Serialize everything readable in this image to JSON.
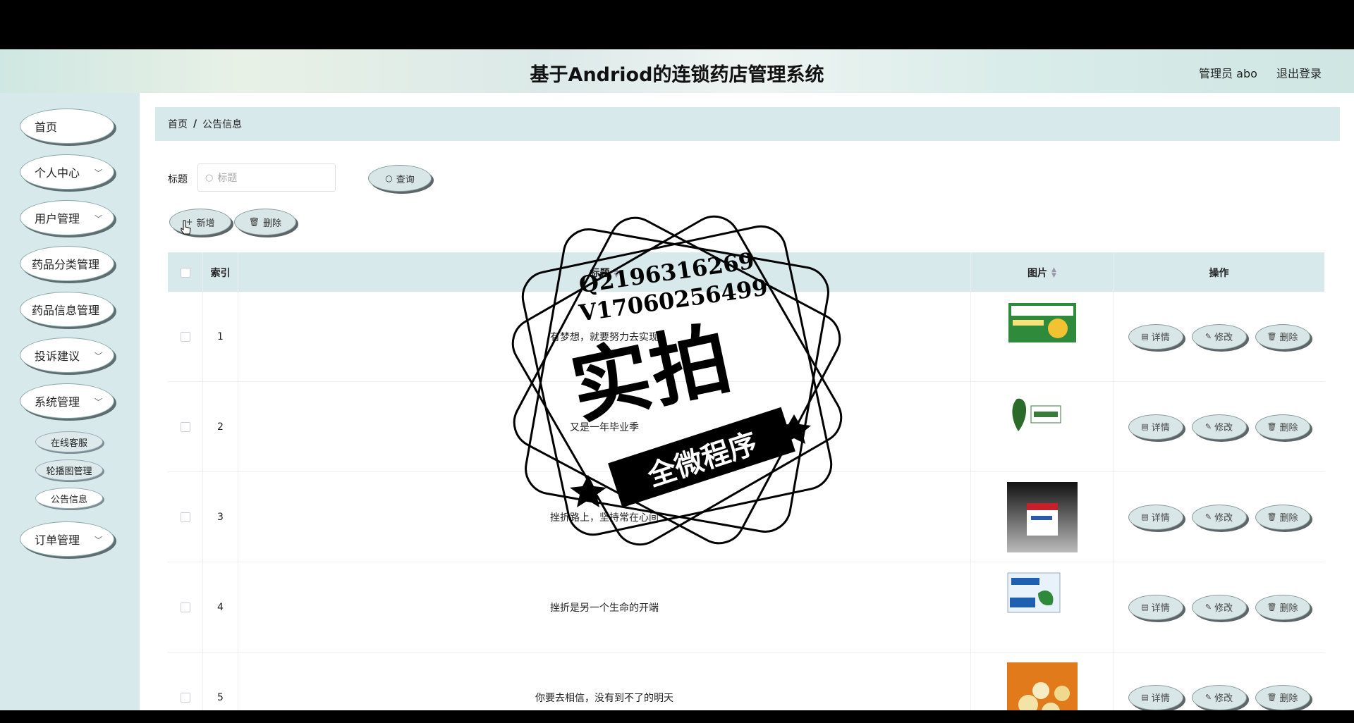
{
  "header": {
    "title": "基于Andriod的连锁药店管理系统",
    "user": "管理员 abo",
    "logout": "退出登录"
  },
  "sidebar": {
    "items": [
      {
        "label": "首页"
      },
      {
        "label": "个人中心"
      },
      {
        "label": "用户管理"
      },
      {
        "label": "药品分类管理"
      },
      {
        "label": "药品信息管理"
      },
      {
        "label": "投诉建议"
      },
      {
        "label": "系统管理"
      },
      {
        "label": "订单管理"
      }
    ],
    "sub_items": [
      {
        "label": "在线客服"
      },
      {
        "label": "轮播图管理"
      },
      {
        "label": "公告信息"
      }
    ]
  },
  "breadcrumb": {
    "home": "首页",
    "sep": "/",
    "current": "公告信息"
  },
  "search": {
    "label": "标题",
    "placeholder": "标题",
    "button": "查询"
  },
  "actions": {
    "add": "新增",
    "delete": "删除"
  },
  "table": {
    "headers": {
      "index": "索引",
      "title": "标题",
      "image": "图片",
      "ops": "操作"
    },
    "op_labels": {
      "detail": "详情",
      "edit": "修改",
      "delete": "删除"
    },
    "rows": [
      {
        "index": "1",
        "title": "有梦想，就要努力去实现"
      },
      {
        "index": "2",
        "title": "又是一年毕业季"
      },
      {
        "index": "3",
        "title": "挫折路上，坚持常在心间"
      },
      {
        "index": "4",
        "title": "挫折是另一个生命的开端"
      },
      {
        "index": "5",
        "title": "你要去相信，没有到不了的明天"
      }
    ]
  },
  "watermark": {
    "line1": "Q2196316269",
    "line2": "V17060256499",
    "big": "实拍",
    "band": "全微程序"
  }
}
